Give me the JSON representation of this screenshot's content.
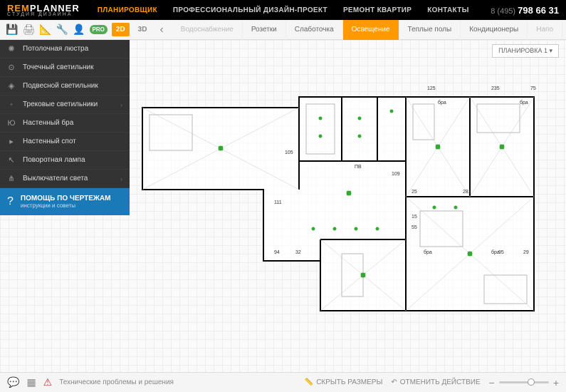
{
  "header": {
    "logo_rem": "REM",
    "logo_planner": "PLANNER",
    "logo_sub": "СТУДИЯ ДИЗАЙНА",
    "nav": [
      "ПЛАНИРОВЩИК",
      "ПРОФЕССИОНАЛЬНЫЙ ДИЗАЙН-ПРОЕКТ",
      "РЕМОНТ КВАРТИР",
      "КОНТАКТЫ"
    ],
    "phone_prefix": "8 (495) ",
    "phone": "798 66 31"
  },
  "toolbar": {
    "pro": "PRO",
    "view2d": "2D",
    "view3d": "3D"
  },
  "tabs": [
    "Водоснабжение",
    "Розетки",
    "Слаботочка",
    "Освещение",
    "Теплые полы",
    "Кондиционеры",
    "Напо"
  ],
  "active_tab_index": 3,
  "sidebar": {
    "items": [
      {
        "icon": "✺",
        "label": "Потолочная люстра"
      },
      {
        "icon": "⊙",
        "label": "Точечный светильник"
      },
      {
        "icon": "◈",
        "label": "Подвесной светильник"
      },
      {
        "icon": "◦",
        "label": "Трековые светильники",
        "arrow": true
      },
      {
        "icon": "Ю",
        "label": "Настенный бра"
      },
      {
        "icon": "▸",
        "label": "Настенный спот"
      },
      {
        "icon": "↖",
        "label": "Поворотная лампа"
      },
      {
        "icon": "⋔",
        "label": "Выключатели света",
        "arrow": true
      }
    ],
    "help_icon": "?",
    "help_title": "ПОМОЩЬ ПО ЧЕРТЕЖАМ",
    "help_sub": "инструкции и советы"
  },
  "plan_selector": "ПЛАНИРОВКА 1  ▾",
  "dimensions": {
    "d1": "125",
    "d2": "235",
    "d3": "75",
    "d4": "105",
    "d5": "109",
    "d6": "281",
    "d7": "111",
    "d8": "94",
    "d9": "32",
    "d10": "15",
    "d11": "55",
    "d12": "25",
    "d13": "95",
    "d14": "29"
  },
  "labels": {
    "bra": "бра",
    "pb": "ПВ"
  },
  "footer": {
    "tech": "Технические проблемы и решения",
    "hide_dims": "СКРЫТЬ РАЗМЕРЫ",
    "undo": "ОТМЕНИТЬ ДЕЙСТВИЕ"
  }
}
